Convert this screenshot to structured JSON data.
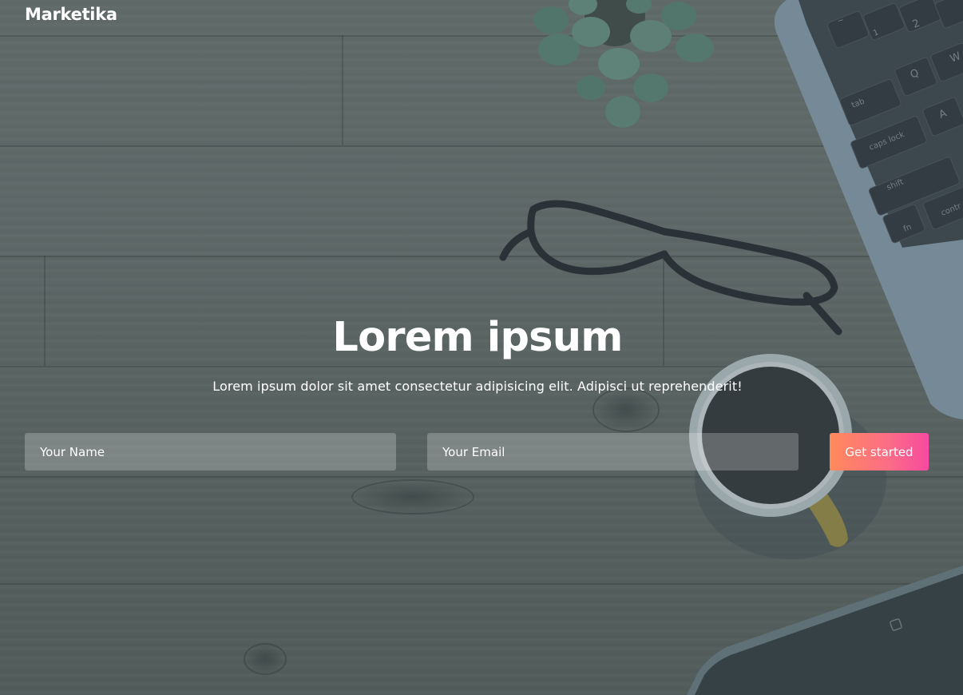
{
  "header": {
    "brand": "Marketika"
  },
  "hero": {
    "title": "Lorem ipsum",
    "subtitle": "Lorem ipsum dolor sit amet consectetur adipisicing elit. Adipisci ut reprehenderit!"
  },
  "form": {
    "name_placeholder": "Your Name",
    "name_value": "",
    "email_placeholder": "Your Email",
    "email_value": "",
    "submit_label": "Get started"
  },
  "background": {
    "laptop_keys": [
      "~",
      "1",
      "2",
      "Q",
      "W",
      "tab",
      "A",
      "caps lock",
      "shift",
      "fn",
      "contr"
    ]
  },
  "colors": {
    "overlay": "#46565c",
    "button_gradient_start": "#ff8a5c",
    "button_gradient_end": "#f74aa0",
    "text": "#ffffff"
  }
}
